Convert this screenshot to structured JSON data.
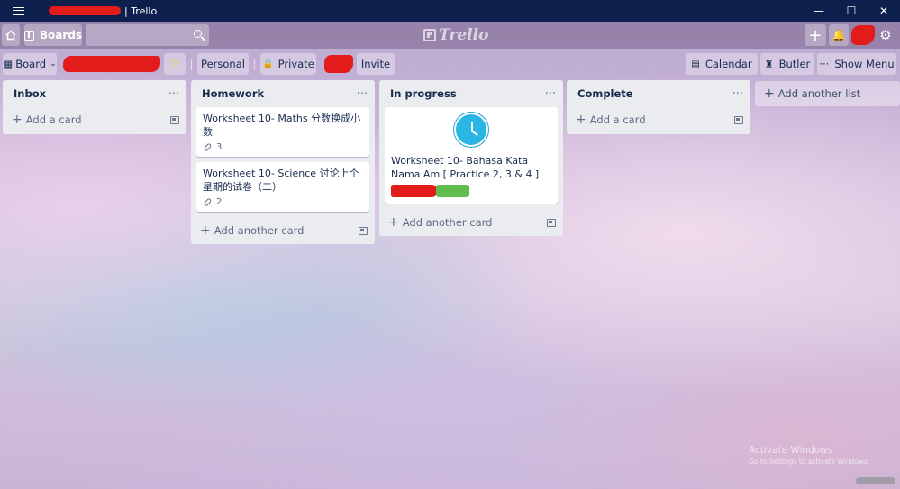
{
  "window": {
    "title": "| Trello",
    "controls": {
      "minimize": "—",
      "maximize": "☐",
      "close": "✕"
    }
  },
  "header": {
    "boards_label": "Boards",
    "search_value": "",
    "logo_text": "Trello",
    "plus_label": "+",
    "bell_label": "🔔",
    "gear_label": "⚙"
  },
  "board_header": {
    "board_switch_label": "Board",
    "team_label": "Personal",
    "visibility_label": "Private",
    "invite_label": "Invite",
    "calendar_label": "Calendar",
    "butler_label": "Butler",
    "menu_label": "Show Menu"
  },
  "lists": [
    {
      "title": "Inbox",
      "add_label": "Add a card",
      "menu": "···",
      "cards": []
    },
    {
      "title": "Homework",
      "add_label": "Add another card",
      "menu": "···",
      "cards": [
        {
          "title": "Worksheet 10- Maths 分数换成小数",
          "attachments": "3"
        },
        {
          "title": "Worksheet 10- Science 讨论上个星期的试卷（二）",
          "attachments": "2"
        }
      ]
    },
    {
      "title": "In progress",
      "add_label": "Add another card",
      "menu": "···",
      "cards": [
        {
          "title": "Worksheet 10- Bahasa Kata Nama Am [ Practice 2, 3 & 4 ]",
          "label_colors": [
            "#e21b1b",
            "#61bd4f"
          ]
        }
      ]
    },
    {
      "title": "Complete",
      "add_label": "Add a card",
      "menu": "···",
      "cards": []
    }
  ],
  "add_list_label": "Add another list",
  "watermark": {
    "line1": "Activate Windows",
    "line2": "Go to Settings to activate Windows."
  },
  "colors": {
    "titlebar": "#0c1f4d",
    "list_bg": "#ebecf0",
    "accent_blue": "#29b6e5"
  }
}
